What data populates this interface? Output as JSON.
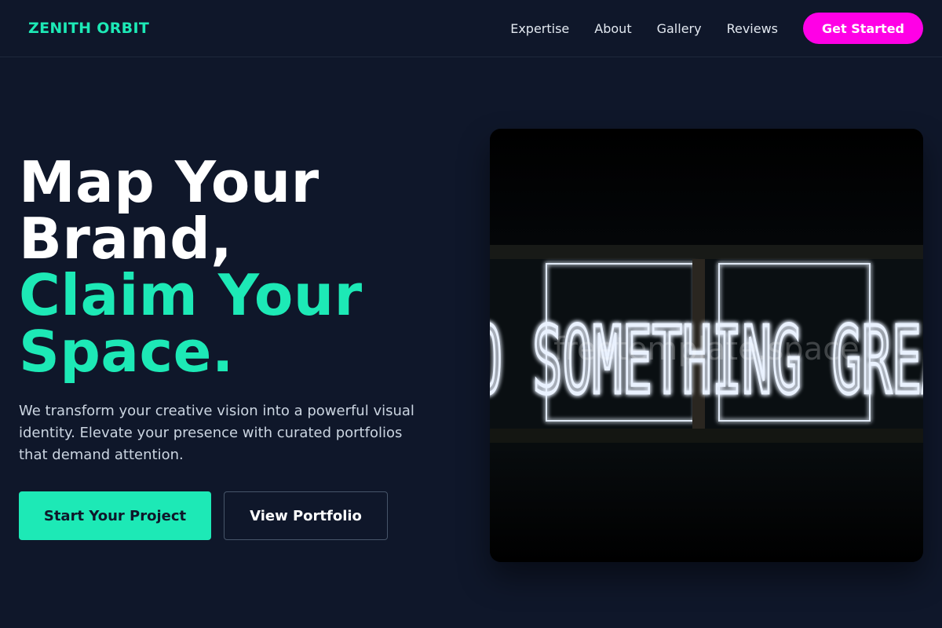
{
  "nav": {
    "logo": "ZENITH ORBIT",
    "links": [
      "Expertise",
      "About",
      "Gallery",
      "Reviews"
    ],
    "cta": "Get Started"
  },
  "hero": {
    "title_line1": "Map Your",
    "title_line2": "Brand,",
    "title_line3": "Claim Your",
    "title_line4": "Space.",
    "description": "We transform your creative vision into a powerful visual identity. Elevate your presence with curated portfolios that demand attention.",
    "primary_button": "Start Your Project",
    "secondary_button": "View Portfolio",
    "image": {
      "neon_text": "O SOMETHING GREA",
      "watermark": "freetemplate.space"
    }
  },
  "colors": {
    "background": "#0f172a",
    "accent": "#1de9b6",
    "cta": "#ff00e6",
    "neon": "#eaf2ff"
  }
}
